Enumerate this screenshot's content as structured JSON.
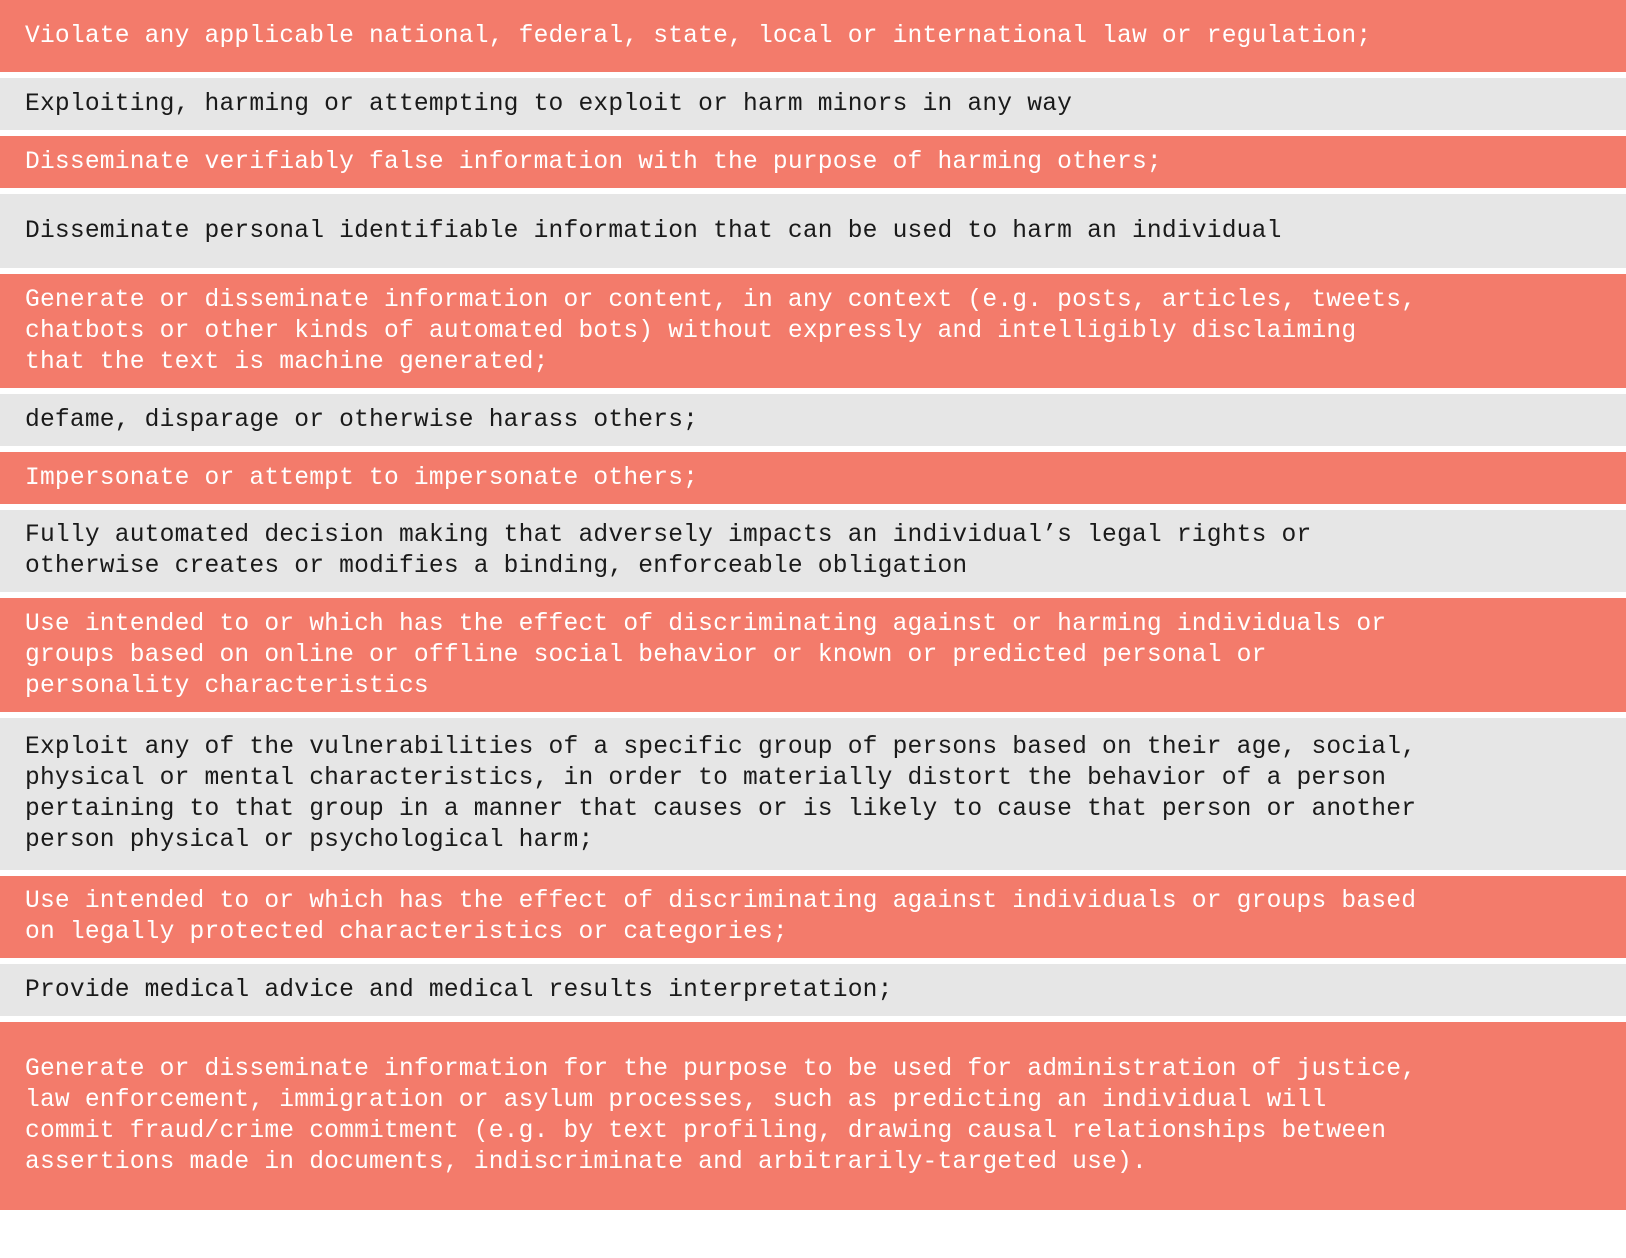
{
  "colors": {
    "prohibited_row_bg": "#f37b6b",
    "prohibited_row_text": "#ffffff",
    "neutral_row_bg": "#e6e6e6",
    "neutral_row_text": "#1a1a1a",
    "separator": "#ffffff"
  },
  "rows": [
    {
      "style": "red",
      "text": "Violate any applicable national, federal, state, local or international law or regulation;"
    },
    {
      "style": "gray",
      "text": "Exploiting, harming or attempting to exploit or harm minors in any way"
    },
    {
      "style": "red",
      "text": "Disseminate verifiably false information with the purpose of harming others;"
    },
    {
      "style": "gray",
      "text": "Disseminate personal identifiable information that can be used to harm an individual"
    },
    {
      "style": "red",
      "text": "Generate or disseminate information or content, in any context (e.g. posts, articles, tweets,\nchatbots or other kinds of automated bots) without expressly and intelligibly disclaiming\nthat the text is machine generated;"
    },
    {
      "style": "gray",
      "text": "defame, disparage or otherwise harass others;"
    },
    {
      "style": "red",
      "text": "Impersonate or attempt to impersonate others;"
    },
    {
      "style": "gray",
      "text": "Fully automated decision making that adversely impacts an individual’s legal rights or\notherwise creates or modifies a binding, enforceable obligation"
    },
    {
      "style": "red",
      "text": "Use intended to or which has the effect of discriminating against or harming individuals or\ngroups based on online or offline social behavior or known or predicted personal or\npersonality characteristics"
    },
    {
      "style": "gray",
      "text": "Exploit any of the vulnerabilities of a specific group of persons based on their age, social,\nphysical or mental characteristics, in order to materially distort the behavior of a person\npertaining to that group in a manner that causes or is likely to cause that person or another\nperson physical or psychological harm;"
    },
    {
      "style": "red",
      "text": "Use intended to or which has the effect of discriminating against individuals or groups based\non legally protected characteristics or categories;"
    },
    {
      "style": "gray",
      "text": "Provide medical advice and medical results interpretation;"
    },
    {
      "style": "red",
      "text": "Generate or disseminate information for the purpose to be used for administration of justice,\nlaw enforcement, immigration or asylum processes, such as predicting an individual will\ncommit fraud/crime commitment (e.g. by text profiling, drawing causal relationships between\nassertions made in documents, indiscriminate and arbitrarily-targeted use)."
    }
  ]
}
